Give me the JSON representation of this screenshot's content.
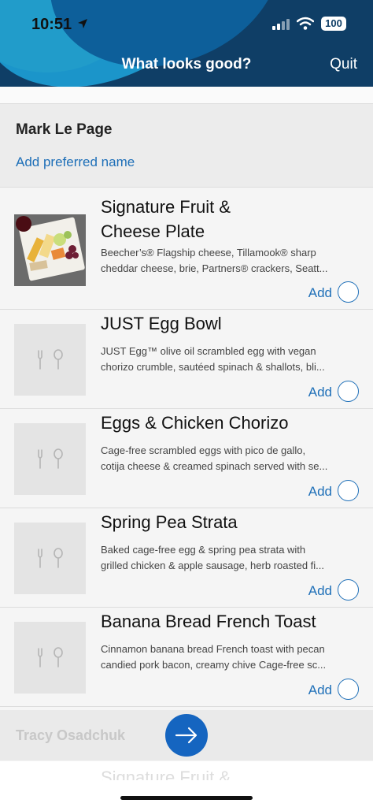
{
  "status_bar": {
    "time": "10:51",
    "battery": "100"
  },
  "header": {
    "title": "What looks good?",
    "quit_label": "Quit"
  },
  "guest": {
    "name": "Mark Le Page",
    "preferred_name_link": "Add preferred name"
  },
  "menu_items": [
    {
      "title_line1": "Signature Fruit &",
      "title_line2": "Cheese Plate",
      "desc_line1": "Beecher’s® Flagship cheese, Tillamook® sharp",
      "desc_line2": "cheddar cheese, brie, Partners® crackers, Seatt...",
      "add_label": "Add"
    },
    {
      "title_line1": "JUST Egg Bowl",
      "desc_line1": "JUST Egg™ olive oil scrambled egg with vegan",
      "desc_line2": "chorizo crumble, sautéed spinach & shallots, bli...",
      "add_label": "Add"
    },
    {
      "title_line1": "Eggs & Chicken Chorizo",
      "desc_line1": "Cage-free scrambled eggs with pico de gallo,",
      "desc_line2": "cotija cheese & creamed spinach served with se...",
      "add_label": "Add"
    },
    {
      "title_line1": "Spring Pea Strata",
      "desc_line1": "Baked cage-free egg & spring pea strata with",
      "desc_line2": "grilled chicken & apple sausage, herb roasted fi...",
      "add_label": "Add"
    },
    {
      "title_line1": "Banana Bread French Toast",
      "desc_line1": "Cinnamon banana bread French toast with pecan",
      "desc_line2": "candied pork bacon, creamy chive Cage-free sc...",
      "add_label": "Add"
    }
  ],
  "next_guest": {
    "name": "Tracy Osadchuk"
  },
  "peek_text": "Signature Fruit &",
  "colors": {
    "header_bg": "#0f3e66",
    "accent_blue": "#1e6fb8",
    "next_button": "#1565c0"
  }
}
